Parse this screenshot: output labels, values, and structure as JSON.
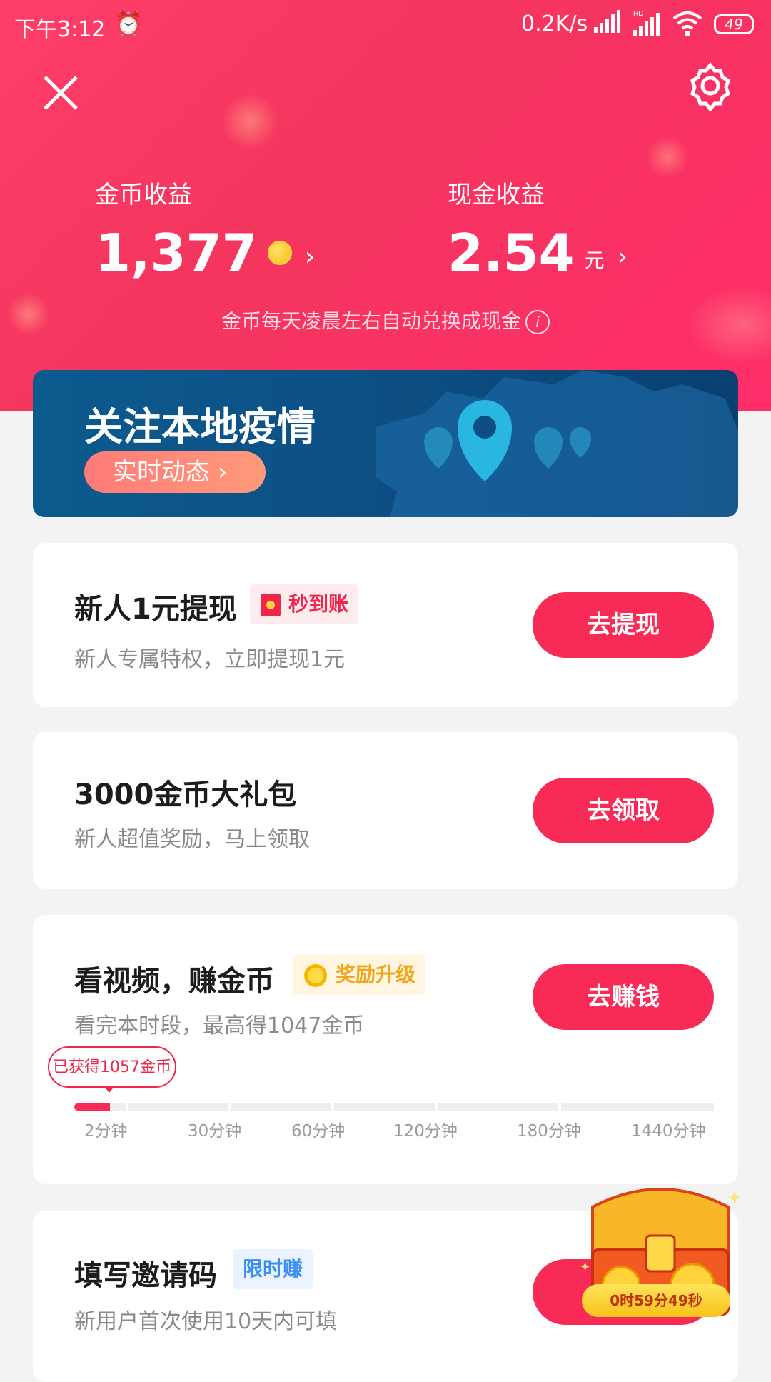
{
  "status_bar": {
    "time": "下午3:12",
    "net_speed": "0.2K/s",
    "battery": "49"
  },
  "earnings": {
    "coin_label": "金币收益",
    "coin_value": "1,377",
    "cash_label": "现金收益",
    "cash_value": "2.54",
    "cash_unit": "元",
    "notice": "金币每天凌晨左右自动兑换成现金"
  },
  "banner": {
    "title": "关注本地疫情",
    "button": "实时动态"
  },
  "tasks": [
    {
      "title": "新人1元提现",
      "tag": "秒到账",
      "subtitle": "新人专属特权，立即提现1元",
      "button": "去提现"
    },
    {
      "title": "3000金币大礼包",
      "subtitle": "新人超值奖励，马上领取",
      "button": "去领取"
    },
    {
      "title": "看视频，赚金币",
      "tag": "奖励升级",
      "subtitle": "看完本时段，最高得1047金币",
      "button": "去赚钱",
      "earned": "已获得1057金币",
      "ticks": [
        "2分钟",
        "30分钟",
        "60分钟",
        "120分钟",
        "180分钟",
        "1440分钟"
      ]
    },
    {
      "title": "填写邀请码",
      "tag": "限时赚",
      "subtitle": "新用户首次使用10天内可填"
    }
  ],
  "chest": {
    "timer": "0时59分49秒"
  },
  "colors": {
    "accent": "#f82a56",
    "banner": "#0d4f84"
  }
}
